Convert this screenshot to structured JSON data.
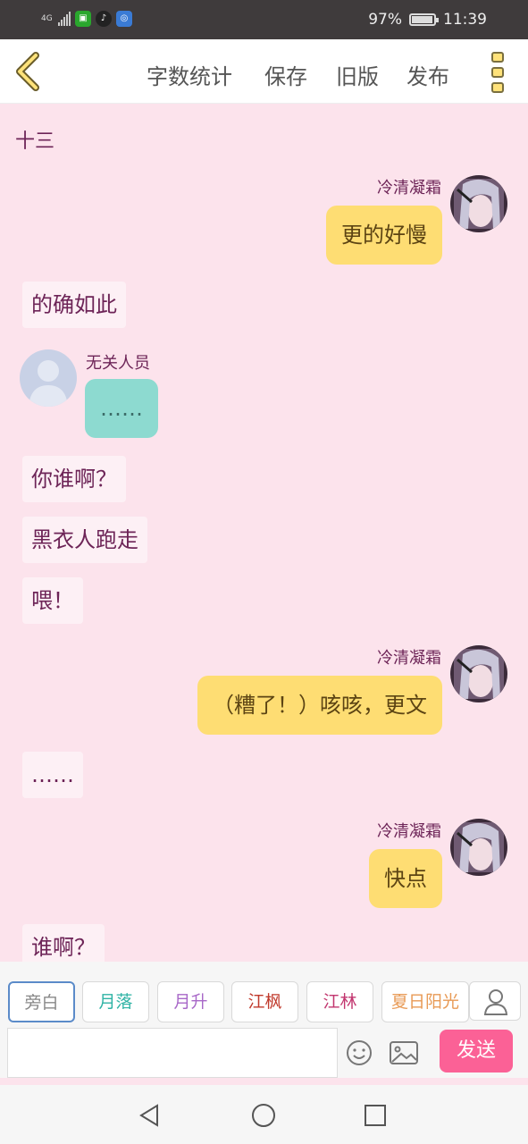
{
  "status": {
    "network": "4G",
    "battery": "97%",
    "battery_level": 0.97,
    "time": "11:39",
    "app_icons": [
      "iqiyi-icon",
      "tiktok-icon",
      "share-app-icon"
    ]
  },
  "nav": {
    "items": [
      "字数统计",
      "保存",
      "旧版",
      "发布"
    ]
  },
  "chat": {
    "chapter": "十三",
    "messages": [
      {
        "type": "right",
        "name": "冷清凝霜",
        "text": "更的好慢"
      },
      {
        "type": "narration",
        "text": "的确如此"
      },
      {
        "type": "left",
        "name": "无关人员",
        "text": "……"
      },
      {
        "type": "narration",
        "text": "你谁啊？"
      },
      {
        "type": "narration",
        "text": "黑衣人跑走"
      },
      {
        "type": "narration",
        "text": "喂！"
      },
      {
        "type": "right",
        "name": "冷清凝霜",
        "text": "（糟了！）咳咳，更文"
      },
      {
        "type": "narration",
        "text": "……"
      },
      {
        "type": "right",
        "name": "冷清凝霜",
        "text": "快点"
      },
      {
        "type": "narration",
        "text": "谁啊？"
      }
    ]
  },
  "roles": [
    {
      "label": "旁白",
      "color": "#888888"
    },
    {
      "label": "月落",
      "color": "#2fb3a5"
    },
    {
      "label": "月升",
      "color": "#a868c8"
    },
    {
      "label": "江枫",
      "color": "#c0392b"
    },
    {
      "label": "江林",
      "color": "#c2366f"
    },
    {
      "label": "夏日阳光",
      "color": "#e89a55"
    }
  ],
  "composer": {
    "placeholder": "",
    "send_label": "发送"
  },
  "colors": {
    "background": "#fce3ec",
    "bubble_yellow": "#fedd73",
    "bubble_teal": "#8ddad0",
    "send": "#fb6196"
  }
}
